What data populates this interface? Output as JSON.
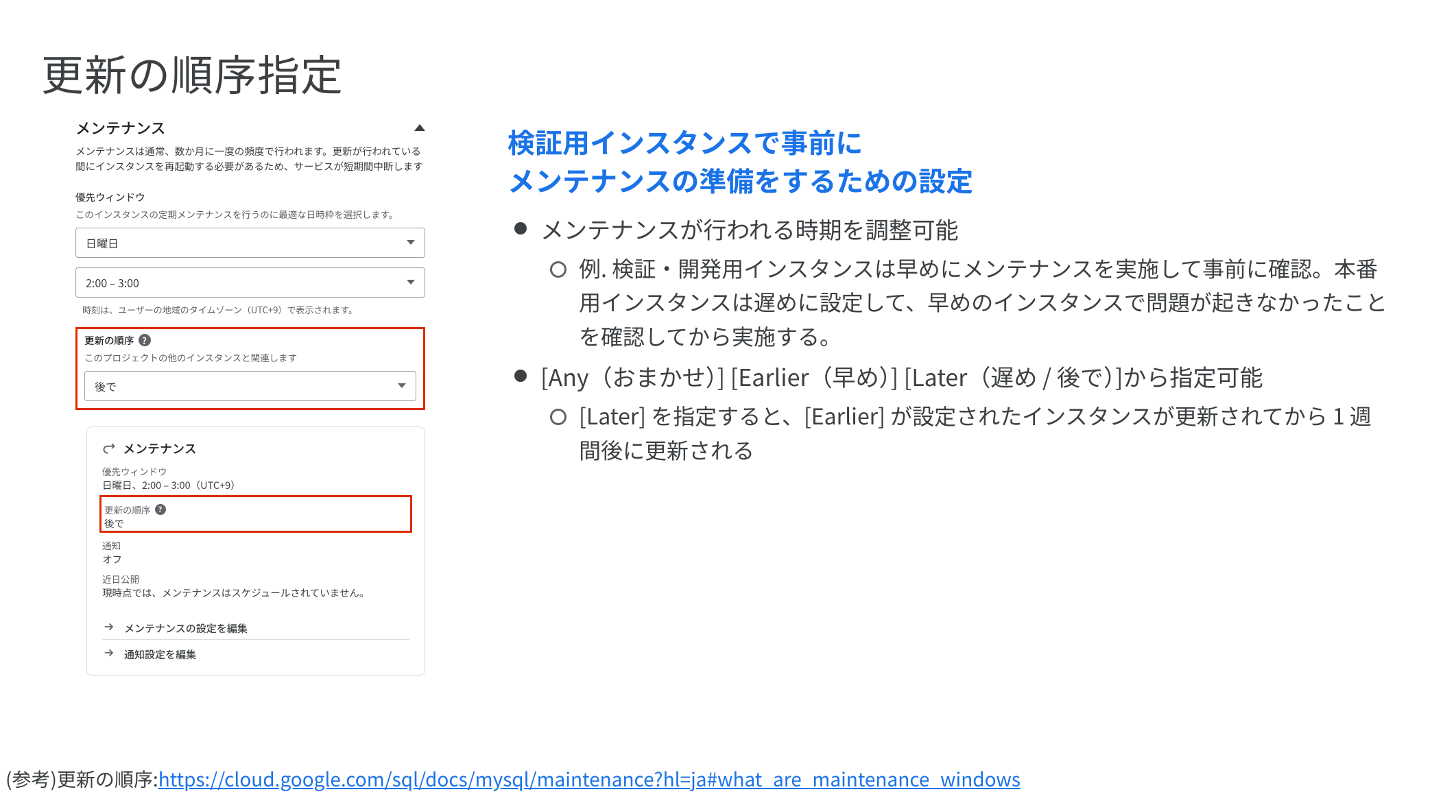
{
  "slide_title": "更新の順序指定",
  "left": {
    "panel_title": "メンテナンス",
    "panel_desc": "メンテナンスは通常、数か月に一度の頻度で行われます。更新が行われている間にインスタンスを再起動する必要があるため、サービスが短期間中断します",
    "pref_window_h": "優先ウィンドウ",
    "pref_window_d": "このインスタンスの定期メンテナンスを行うのに最適な日時枠を選択します。",
    "day_value": "日曜日",
    "time_value": "2:00 – 3:00",
    "tz_note": "時刻は、ユーザーの地域のタイムゾーン（UTC+9）で表示されます。",
    "order_h": "更新の順序",
    "order_d": "このプロジェクトの他のインスタンスと関連します",
    "order_value": "後で"
  },
  "card": {
    "title": "メンテナンス",
    "pref_lbl": "優先ウィンドウ",
    "pref_val": "日曜日、2:00 – 3:00（UTC+9）",
    "order_lbl": "更新の順序",
    "order_val": "後で",
    "notif_lbl": "通知",
    "notif_val": "オフ",
    "upcoming_lbl": "近日公開",
    "upcoming_val": "現時点では、メンテナンスはスケジュールされていません。",
    "link_edit_m": "メンテナンスの設定を編集",
    "link_edit_n": "通知設定を編集"
  },
  "right": {
    "heading_line1": "検証用インスタンスで事前に",
    "heading_line2": "メンテナンスの準備をするための設定",
    "b1": "メンテナンスが行われる時期を調整可能",
    "b1_s1": "例. 検証・開発用インスタンスは早めにメンテナンスを実施して事前に確認。本番用インスタンスは遅めに設定して、早めのインスタンスで問題が起きなかったことを確認してから実施する。",
    "b2": "[Any（おまかせ）] [Earlier（早め）] [Later（遅め / 後で）]から指定可能",
    "b2_s1": "[Later] を指定すると、[Earlier] が設定されたインスタンスが更新されてから 1 週間後に更新される"
  },
  "footer": {
    "prefix": "(参考)更新の順序:",
    "url": "https://cloud.google.com/sql/docs/mysql/maintenance?hl=ja#what_are_maintenance_windows"
  }
}
